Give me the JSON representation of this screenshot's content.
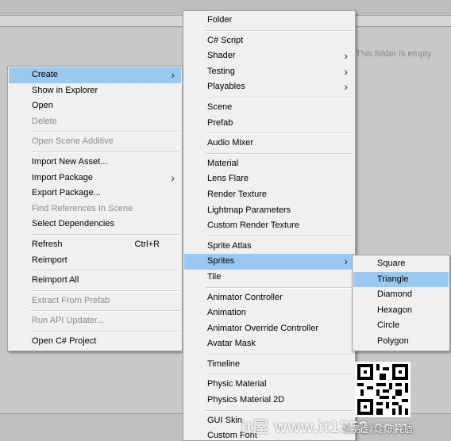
{
  "background": {
    "empty_folder_text": "This folder is empty"
  },
  "context_menu": {
    "items": [
      {
        "label": "Create",
        "has_submenu": true,
        "highlighted": true
      },
      {
        "label": "Show in Explorer"
      },
      {
        "label": "Open"
      },
      {
        "label": "Delete",
        "disabled": true
      },
      {
        "separator": true
      },
      {
        "label": "Open Scene Additive",
        "disabled": true
      },
      {
        "separator": true
      },
      {
        "label": "Import New Asset..."
      },
      {
        "label": "Import Package",
        "has_submenu": true
      },
      {
        "label": "Export Package..."
      },
      {
        "label": "Find References In Scene",
        "disabled": true
      },
      {
        "label": "Select Dependencies"
      },
      {
        "separator": true
      },
      {
        "label": "Refresh",
        "shortcut": "Ctrl+R"
      },
      {
        "label": "Reimport"
      },
      {
        "separator": true
      },
      {
        "label": "Reimport All"
      },
      {
        "separator": true
      },
      {
        "label": "Extract From Prefab",
        "disabled": true
      },
      {
        "separator": true
      },
      {
        "label": "Run API Updater...",
        "disabled": true
      },
      {
        "separator": true
      },
      {
        "label": "Open C# Project"
      }
    ]
  },
  "create_menu": {
    "items": [
      {
        "label": "Folder"
      },
      {
        "separator": true
      },
      {
        "label": "C# Script"
      },
      {
        "label": "Shader",
        "has_submenu": true
      },
      {
        "label": "Testing",
        "has_submenu": true
      },
      {
        "label": "Playables",
        "has_submenu": true
      },
      {
        "separator": true
      },
      {
        "label": "Scene"
      },
      {
        "label": "Prefab"
      },
      {
        "separator": true
      },
      {
        "label": "Audio Mixer"
      },
      {
        "separator": true
      },
      {
        "label": "Material"
      },
      {
        "label": "Lens Flare"
      },
      {
        "label": "Render Texture"
      },
      {
        "label": "Lightmap Parameters"
      },
      {
        "label": "Custom Render Texture"
      },
      {
        "separator": true
      },
      {
        "label": "Sprite Atlas"
      },
      {
        "label": "Sprites",
        "has_submenu": true,
        "highlighted": true
      },
      {
        "label": "Tile"
      },
      {
        "separator": true
      },
      {
        "label": "Animator Controller"
      },
      {
        "label": "Animation"
      },
      {
        "label": "Animator Override Controller"
      },
      {
        "label": "Avatar Mask"
      },
      {
        "separator": true
      },
      {
        "label": "Timeline"
      },
      {
        "separator": true
      },
      {
        "label": "Physic Material"
      },
      {
        "label": "Physics Material 2D"
      },
      {
        "separator": true
      },
      {
        "label": "GUI Skin"
      },
      {
        "label": "Custom Font"
      }
    ]
  },
  "sprites_menu": {
    "items": [
      {
        "label": "Square"
      },
      {
        "label": "Triangle",
        "highlighted": true
      },
      {
        "label": "Diamond"
      },
      {
        "label": "Hexagon"
      },
      {
        "label": "Circle"
      },
      {
        "label": "Polygon"
      }
    ]
  },
  "watermark": {
    "site_text": "it屋 www.it1352.com",
    "caption": "优品虚拟会员充值"
  },
  "icons": {
    "submenu_arrow": "chevron-right-icon",
    "qr_code": "qr-code-icon"
  }
}
